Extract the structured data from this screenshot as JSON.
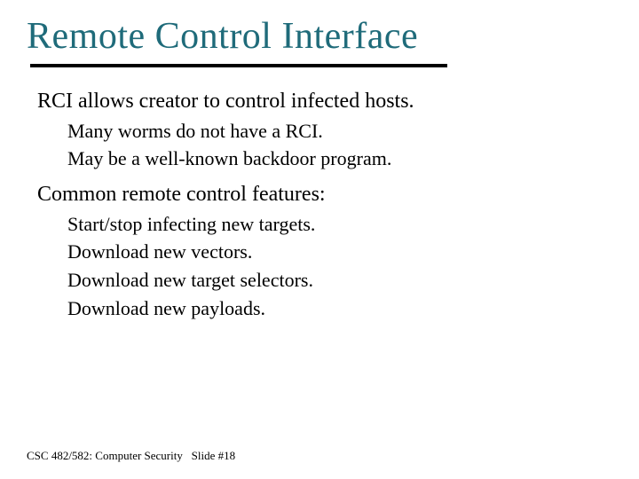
{
  "title": "Remote Control Interface",
  "content": {
    "p1": "RCI allows creator to control infected hosts.",
    "p1_sub1": "Many worms do not have a RCI.",
    "p1_sub2": "May be a well-known backdoor program.",
    "p2": "Common remote control features:",
    "p2_sub1": "Start/stop infecting new targets.",
    "p2_sub2": "Download new vectors.",
    "p2_sub3": "Download new target selectors.",
    "p2_sub4": "Download new payloads."
  },
  "footer": {
    "course": "CSC 482/582: Computer Security",
    "slide": "Slide #18"
  }
}
